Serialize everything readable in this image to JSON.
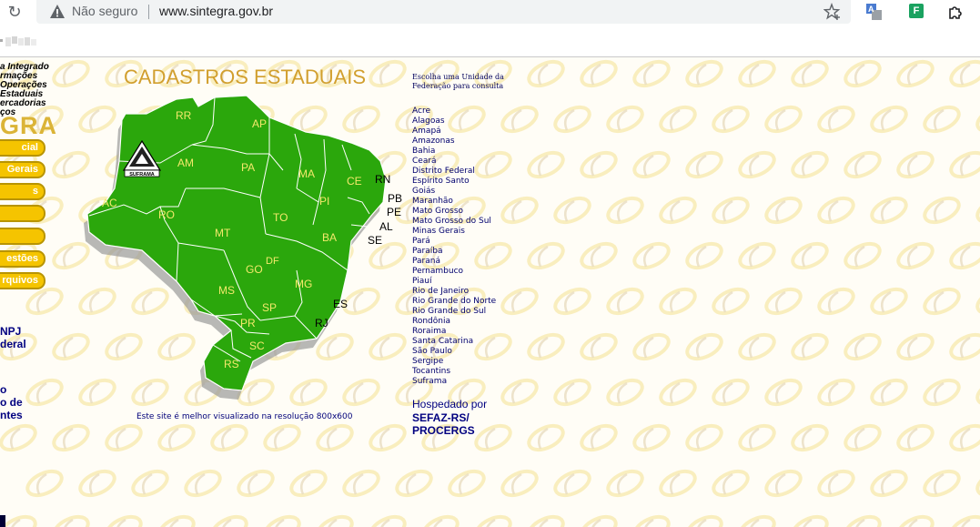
{
  "browser": {
    "security_label": "Não seguro",
    "url": "www.sintegra.gov.br"
  },
  "sidebar": {
    "banner_lines": [
      "a Integrado",
      "rmações",
      "Operações",
      "Estaduais",
      "ercadorias",
      "ços"
    ],
    "brand": "GRA",
    "buttons": [
      "cial",
      "Gerais",
      "s",
      "",
      "",
      "estões",
      "rquivos"
    ],
    "links": [
      "NPJ",
      "deral",
      "o",
      "o de",
      "ntes"
    ]
  },
  "main": {
    "title": "CADASTROS ESTADUAIS",
    "resolution_note": "Este site é melhor visualizado na resolução 800x600"
  },
  "map": {
    "logo_text": "SUFRAMA",
    "state_labels": [
      "RR",
      "AP",
      "AM",
      "PA",
      "MA",
      "CE",
      "RN",
      "PB",
      "PE",
      "AL",
      "SE",
      "PI",
      "AC",
      "RO",
      "TO",
      "MT",
      "BA",
      "GO",
      "DF",
      "MS",
      "MG",
      "ES",
      "RJ",
      "SP",
      "PR",
      "SC",
      "RS"
    ],
    "fill_color": "#2ba70c"
  },
  "right": {
    "instruction": "Escolha uma Unidade da Federação para consulta",
    "states": [
      "Acre",
      "Alagoas",
      "Amapá",
      "Amazonas",
      "Bahia",
      "Ceará",
      "Distrito Federal",
      "Espírito Santo",
      "Goiás",
      "Maranhão",
      "Mato Grosso",
      "Mato Grosso do Sul",
      "Minas Gerais",
      "Pará",
      "Paraíba",
      "Paraná",
      "Pernambuco",
      "Piauí",
      "Rio de Janeiro",
      "Rio Grande do Norte",
      "Rio Grande do Sul",
      "Rondônia",
      "Roraima",
      "Santa Catarina",
      "São Paulo",
      "Sergipe",
      "Tocantins",
      "Suframa"
    ],
    "hosted_label": "Hospedado por",
    "hosted_org_1": "SEFAZ-RS/",
    "hosted_org_2": "PROCERGS"
  }
}
